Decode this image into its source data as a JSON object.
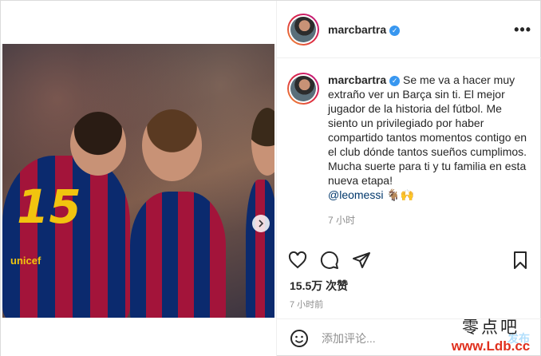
{
  "media": {
    "jersey_number": "15",
    "sponsor_text": "unicef",
    "carousel_dots": 4,
    "active_dot": 0
  },
  "header": {
    "username": "marcbartra",
    "more_icon": "more-horizontal-icon"
  },
  "caption": {
    "username": "marcbartra",
    "text": "Se me va a hacer muy extraño ver un Barça sin ti. El mejor jugador de la historia del fútbol. Me siento un privilegiado por haber compartido tantos momentos contigo en el club dónde tantos sueños cumplimos. Mucha suerte para ti y tu familia en esta nueva etapa!",
    "mention": "@leomessi",
    "emojis": "🐐🙌",
    "time": "7 小时"
  },
  "actions": {
    "like_icon": "heart-icon",
    "comment_icon": "comment-icon",
    "share_icon": "share-icon",
    "save_icon": "bookmark-icon"
  },
  "likes": "15.5万 次赞",
  "post_time": "7 小时前",
  "comment": {
    "placeholder": "添加评论...",
    "post_label": "发布"
  },
  "watermark": {
    "top": "零点吧",
    "bottom": "www.Ldb.cc"
  },
  "colors": {
    "verified": "#3897f0",
    "link": "#00376b",
    "post_button": "#b2dffc",
    "watermark": "#e0301e"
  }
}
